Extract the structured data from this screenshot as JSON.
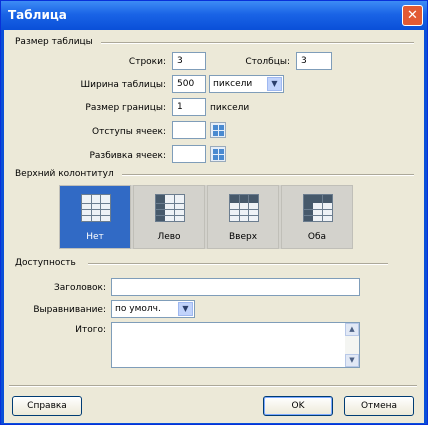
{
  "window": {
    "title": "Таблица",
    "close": "✕"
  },
  "size_section": {
    "title": "Размер таблицы",
    "rows_label": "Строки:",
    "rows_value": "3",
    "cols_label": "Столбцы:",
    "cols_value": "3",
    "width_label": "Ширина таблицы:",
    "width_value": "500",
    "width_unit": "пиксели",
    "border_label": "Размер границы:",
    "border_value": "1",
    "border_unit": "пиксели",
    "padding_label": "Отступы ячеек:",
    "padding_value": "",
    "spacing_label": "Разбивка ячеек:",
    "spacing_value": ""
  },
  "header_section": {
    "title": "Верхний колонтитул",
    "options": [
      {
        "label": "Нет",
        "selected": true
      },
      {
        "label": "Лево",
        "selected": false
      },
      {
        "label": "Вверх",
        "selected": false
      },
      {
        "label": "Оба",
        "selected": false
      }
    ]
  },
  "access_section": {
    "title": "Доступность",
    "caption_label": "Заголовок:",
    "caption_value": "",
    "align_label": "Выравнивание:",
    "align_value": "по умолч.",
    "summary_label": "Итого:",
    "summary_value": ""
  },
  "buttons": {
    "help": "Справка",
    "ok": "OK",
    "cancel": "Отмена"
  }
}
